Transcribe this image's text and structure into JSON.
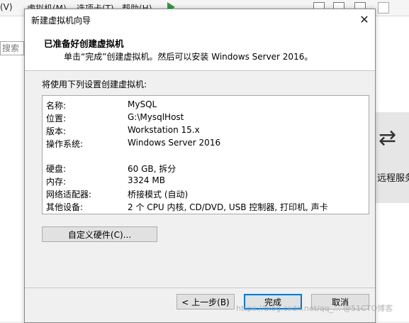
{
  "background_app": {
    "menu": [
      "(V)",
      "虚拟机(M)",
      "选项卡(T)",
      "帮助(H)"
    ],
    "search_placeholder": "搜索",
    "remote_label": "远程服务"
  },
  "watermark": "https://blog.csdn.net/qq_... @51CTO博客",
  "dialog": {
    "title": "新建虚拟机向导",
    "header_title": "已准备好创建虚拟机",
    "header_subtitle": "单击“完成”创建虚拟机。然后可以安装 Windows Server 2016。",
    "intro": "将使用下列设置创建虚拟机:",
    "settings": [
      {
        "key": "名称:",
        "value": "MySQL"
      },
      {
        "key": "位置:",
        "value": "G:\\MysqlHost"
      },
      {
        "key": "版本:",
        "value": "Workstation 15.x"
      },
      {
        "key": "操作系统:",
        "value": "Windows Server 2016"
      },
      {
        "key": "硬盘:",
        "value": "60 GB, 拆分"
      },
      {
        "key": "内存:",
        "value": "3324 MB"
      },
      {
        "key": "网络适配器:",
        "value": "桥接模式 (自动)"
      },
      {
        "key": "其他设备:",
        "value": "2 个 CPU 内核, CD/DVD, USB 控制器, 打印机, 声卡"
      }
    ],
    "customize_button": "自定义硬件(C)...",
    "back_button": "< 上一步(B)",
    "finish_button": "完成",
    "cancel_button": "取消"
  }
}
